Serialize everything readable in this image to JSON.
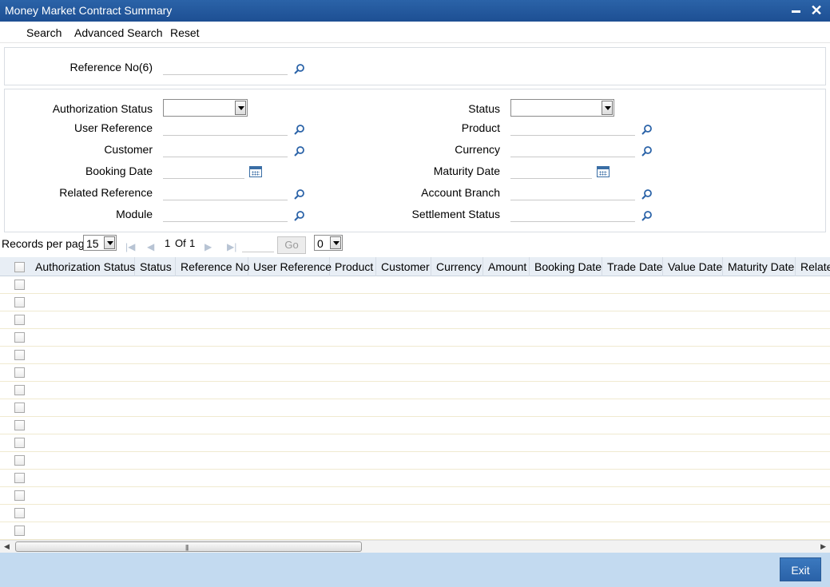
{
  "window": {
    "title": "Money Market Contract Summary",
    "minimize_glyph": "▬",
    "close_glyph": "✕"
  },
  "toolbar": {
    "search": "Search",
    "advanced_search": "Advanced Search",
    "reset": "Reset"
  },
  "reference_panel": {
    "reference_no_label": "Reference No(6)",
    "reference_no_value": ""
  },
  "criteria": {
    "authorization_status_label": "Authorization Status",
    "status_label": "Status",
    "user_reference_label": "User Reference",
    "product_label": "Product",
    "customer_label": "Customer",
    "currency_label": "Currency",
    "booking_date_label": "Booking Date",
    "maturity_date_label": "Maturity Date",
    "related_reference_label": "Related Reference",
    "account_branch_label": "Account Branch",
    "module_label": "Module",
    "settlement_status_label": "Settlement Status"
  },
  "pager": {
    "records_per_page_label": "Records per page",
    "records_per_page_value": "15",
    "page_current": "1",
    "page_of": "Of",
    "page_total": "1",
    "go_label": "Go",
    "jump_value": "0"
  },
  "grid": {
    "columns": [
      "Authorization Status",
      "Status",
      "Reference No",
      "User Reference",
      "Product",
      "Customer",
      "Currency",
      "Amount",
      "Booking Date",
      "Trade Date",
      "Value Date",
      "Maturity Date",
      "Relate"
    ],
    "row_count": 15
  },
  "footer": {
    "exit_label": "Exit"
  },
  "colors": {
    "titlebar": "#1d4f93",
    "footer": "#c3daf0",
    "exit_button": "#2a62a8",
    "grid_header": "#e8eef5"
  },
  "icons": [
    "search-icon",
    "calendar-icon",
    "dropdown-arrow-icon",
    "first-page-icon",
    "prev-page-icon",
    "next-page-icon",
    "last-page-icon",
    "minimize-icon",
    "close-icon"
  ]
}
